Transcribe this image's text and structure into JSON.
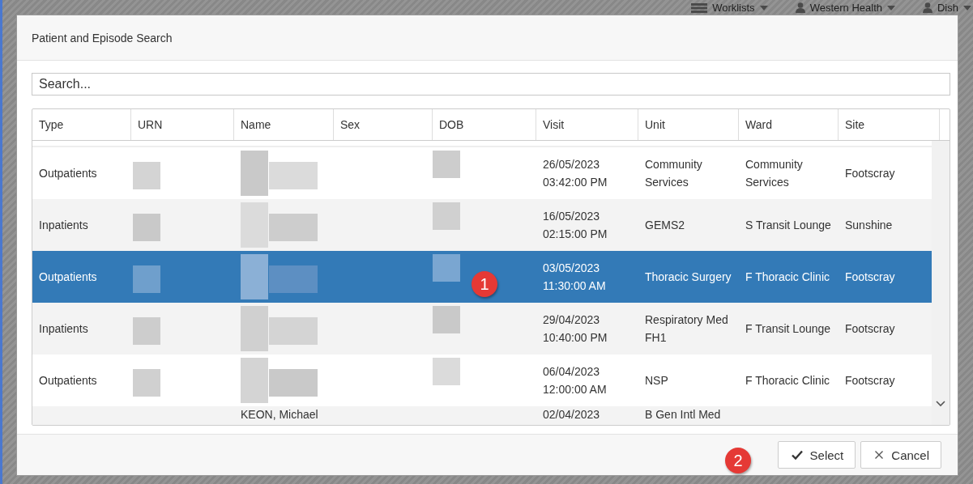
{
  "background_nav": [
    {
      "label": "Worklists"
    },
    {
      "label": "Western Health"
    },
    {
      "label": "Dish"
    }
  ],
  "dialog": {
    "title": "Patient and Episode Search",
    "search": {
      "placeholder": "Search..."
    },
    "table": {
      "columns": [
        "Type",
        "URN",
        "Name",
        "Sex",
        "DOB",
        "Visit",
        "Unit",
        "Ward",
        "Site"
      ],
      "rows": [
        {
          "type": "Outpatients",
          "visit_date": "26/05/2023",
          "visit_time": "03:42:00 PM",
          "unit": "Community Services",
          "ward": "Community Services",
          "site": "Footscray",
          "selected": false
        },
        {
          "type": "Inpatients",
          "visit_date": "16/05/2023",
          "visit_time": "02:15:00 PM",
          "unit": "GEMS2",
          "ward": "S Transit Lounge",
          "site": "Sunshine",
          "selected": false
        },
        {
          "type": "Outpatients",
          "visit_date": "03/05/2023",
          "visit_time": "11:30:00 AM",
          "unit": "Thoracic Surgery",
          "ward": "F Thoracic Clinic",
          "site": "Footscray",
          "selected": true
        },
        {
          "type": "Inpatients",
          "visit_date": "29/04/2023",
          "visit_time": "10:40:00 PM",
          "unit": "Respiratory Med FH1",
          "ward": "F Transit Lounge",
          "site": "Footscray",
          "selected": false
        },
        {
          "type": "Outpatients",
          "visit_date": "06/04/2023",
          "visit_time": "12:00:00 AM",
          "unit": "NSP",
          "ward": "F Thoracic Clinic",
          "site": "Footscray",
          "selected": false
        },
        {
          "name": "KEON, Michael",
          "visit_date": "02/04/2023",
          "unit": "B Gen Intl Med",
          "selected": false
        }
      ]
    },
    "buttons": [
      {
        "label": "Select"
      },
      {
        "label": "Cancel"
      }
    ]
  },
  "annotations": [
    {
      "label": "1"
    },
    {
      "label": "2"
    }
  ]
}
